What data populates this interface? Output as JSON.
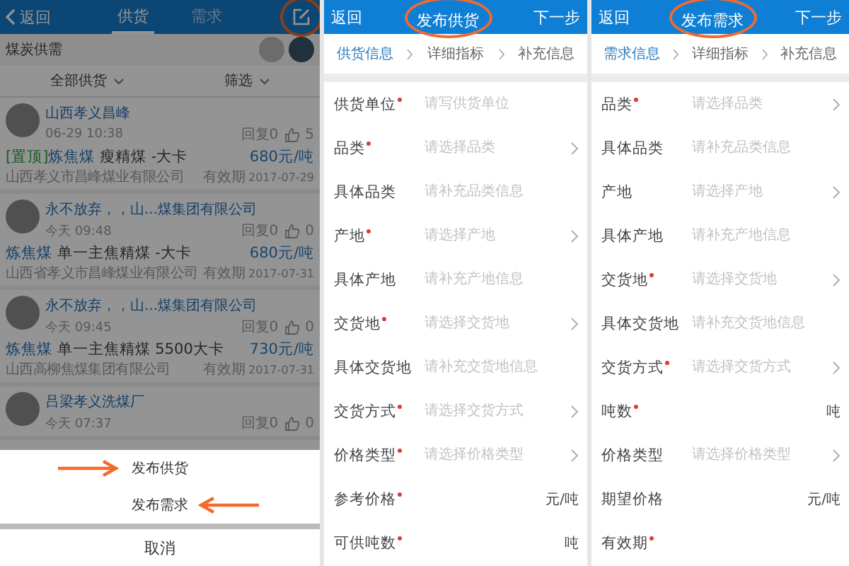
{
  "supply_list_screen": {
    "header": {
      "back": "返回",
      "tabs": [
        {
          "label": "供货",
          "selected": true
        },
        {
          "label": "需求",
          "selected": false
        }
      ]
    },
    "section_title": "煤炭供需",
    "filters": [
      {
        "label": "全部供货"
      },
      {
        "label": "筛选"
      }
    ],
    "listings": [
      {
        "poster": "山西孝义昌峰",
        "time": "06-29 10:38",
        "replies": "回复0",
        "likes": "5",
        "pinned_tag": "[置顶]",
        "category": "炼焦煤",
        "title": "瘦精煤 -大卡",
        "price": "680元/吨",
        "company": "山西孝义市昌峰煤业有限公司",
        "expiry_label": "有效期",
        "expiry": "2017-07-29"
      },
      {
        "poster": "永不放弃，，山...煤集团有限公司",
        "time": "今天 09:48",
        "replies": "回复0",
        "likes": "0",
        "category": "炼焦煤",
        "title": "单一主焦精煤 -大卡",
        "price": "680元/吨",
        "company": "山西省孝义市昌峰煤业有限公司",
        "expiry_label": "有效期",
        "expiry": "2017-07-31"
      },
      {
        "poster": "永不放弃，，山...煤集团有限公司",
        "time": "今天 09:45",
        "replies": "回复0",
        "likes": "0",
        "category": "炼焦煤",
        "title": "单一主焦精煤 5500大卡",
        "price": "730元/吨",
        "company": "山西高柳焦煤集团有限公司",
        "expiry_label": "有效期",
        "expiry": "2017-07-31"
      },
      {
        "poster": "吕梁孝义洗煤厂",
        "time": "今天 07:37",
        "replies": "回复0",
        "likes": "0"
      }
    ],
    "action_sheet": {
      "items": [
        "发布供货",
        "发布需求"
      ],
      "cancel": "取消"
    }
  },
  "supply_form": {
    "header": {
      "back": "返回",
      "title": "发布供货",
      "next": "下一步"
    },
    "steps": [
      {
        "label": "供货信息",
        "selected": true
      },
      {
        "label": "详细指标",
        "selected": false
      },
      {
        "label": "补充信息",
        "selected": false
      }
    ],
    "fields": [
      {
        "label": "供货单位",
        "required": true,
        "kind": "input",
        "placeholder": "请写供货单位"
      },
      {
        "label": "品类",
        "required": true,
        "kind": "select",
        "placeholder": "请选择品类"
      },
      {
        "label": "具体品类",
        "required": false,
        "kind": "input",
        "placeholder": "请补充品类信息"
      },
      {
        "label": "产地",
        "required": true,
        "kind": "select",
        "placeholder": "请选择产地"
      },
      {
        "label": "具体产地",
        "required": false,
        "kind": "input",
        "placeholder": "请补充产地信息"
      },
      {
        "label": "交货地",
        "required": true,
        "kind": "select",
        "placeholder": "请选择交货地"
      },
      {
        "label": "具体交货地",
        "required": false,
        "kind": "input",
        "placeholder": "请补充交货地信息"
      },
      {
        "label": "交货方式",
        "required": true,
        "kind": "select",
        "placeholder": "请选择交货方式"
      },
      {
        "label": "价格类型",
        "required": true,
        "kind": "select",
        "placeholder": "请选择价格类型"
      },
      {
        "label": "参考价格",
        "required": true,
        "kind": "unit",
        "unit": "元/吨"
      },
      {
        "label": "可供吨数",
        "required": true,
        "kind": "unit",
        "unit": "吨"
      }
    ]
  },
  "demand_form": {
    "header": {
      "back": "返回",
      "title": "发布需求",
      "next": "下一步"
    },
    "steps": [
      {
        "label": "需求信息",
        "selected": true
      },
      {
        "label": "详细指标",
        "selected": false
      },
      {
        "label": "补充信息",
        "selected": false
      }
    ],
    "fields": [
      {
        "label": "品类",
        "required": true,
        "kind": "select",
        "placeholder": "请选择品类"
      },
      {
        "label": "具体品类",
        "required": false,
        "kind": "input",
        "placeholder": "请补充品类信息"
      },
      {
        "label": "产地",
        "required": false,
        "kind": "select",
        "placeholder": "请选择产地"
      },
      {
        "label": "具体产地",
        "required": false,
        "kind": "input",
        "placeholder": "请补充产地信息"
      },
      {
        "label": "交货地",
        "required": true,
        "kind": "select",
        "placeholder": "请选择交货地"
      },
      {
        "label": "具体交货地",
        "required": false,
        "kind": "input",
        "placeholder": "请补充交货地信息"
      },
      {
        "label": "交货方式",
        "required": true,
        "kind": "select",
        "placeholder": "请选择交货方式"
      },
      {
        "label": "吨数",
        "required": true,
        "kind": "unit",
        "unit": "吨"
      },
      {
        "label": "价格类型",
        "required": false,
        "kind": "select",
        "placeholder": "请选择价格类型"
      },
      {
        "label": "期望价格",
        "required": false,
        "kind": "unit",
        "unit": "元/吨"
      },
      {
        "label": "有效期",
        "required": true,
        "kind": "date"
      }
    ]
  }
}
